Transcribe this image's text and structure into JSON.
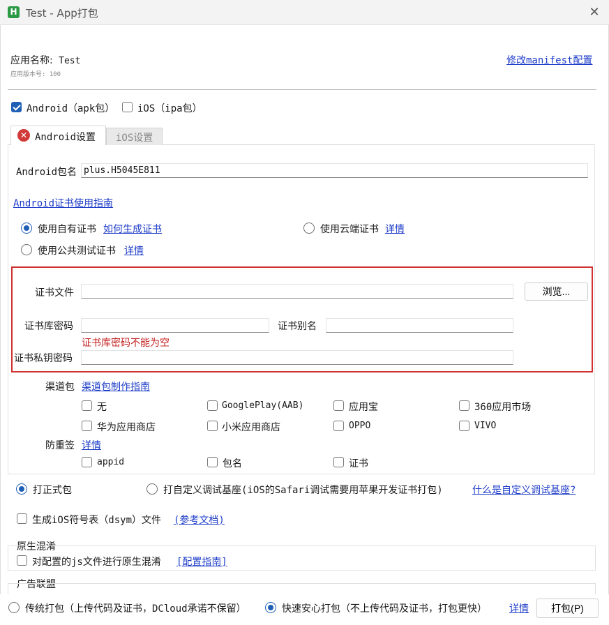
{
  "window": {
    "title": "Test - App打包",
    "app_icon": "H"
  },
  "app_info": {
    "name_label": "应用名称:",
    "name": "Test",
    "version_text": "应用版本号: 100",
    "edit_manifest": "修改manifest配置"
  },
  "platforms": {
    "android": {
      "label": "Android（apk包）",
      "checked": true
    },
    "ios": {
      "label": "iOS（ipa包）",
      "checked": false
    }
  },
  "tabs": {
    "android": "Android设置",
    "ios": "iOS设置"
  },
  "android": {
    "package_label": "Android包名",
    "package_value": "plus.H5045E811",
    "cert_guide": "Android证书使用指南",
    "cert_options": {
      "own": "使用自有证书",
      "own_link": "如何生成证书",
      "cloud": "使用云端证书",
      "cloud_link": "详情",
      "public": "使用公共测试证书",
      "public_link": "详情"
    },
    "cert_file_label": "证书文件",
    "browse_button": "浏览...",
    "keystore_password_label": "证书库密码",
    "alias_label": "证书别名",
    "password_error": "证书库密码不能为空",
    "private_key_label": "证书私钥密码",
    "channel_label": "渠道包",
    "channel_guide": "渠道包制作指南",
    "channels": [
      "无",
      "GooglePlay(AAB)",
      "应用宝",
      "360应用市场",
      "华为应用商店",
      "小米应用商店",
      "OPPO",
      "VIVO"
    ],
    "anti_resign_label": "防重签",
    "anti_resign_link": "详情",
    "anti_resign_options": [
      "appid",
      "包名",
      "证书"
    ]
  },
  "build_type": {
    "release": "打正式包",
    "custom_base": "打自定义调试基座(iOS的Safari调试需要用苹果开发证书打包)",
    "custom_base_link": "什么是自定义调试基座?"
  },
  "dsym": {
    "label": "生成iOS符号表（dsym）文件",
    "link": "(参考文档)"
  },
  "native_obfuscation": {
    "title": "原生混淆",
    "option": "对配置的js文件进行原生混淆",
    "link": "[配置指南]"
  },
  "ad_alliance": {
    "title": "广告联盟"
  },
  "footer": {
    "traditional": "传统打包（上传代码及证书，DCloud承诺不保留）",
    "fast": "快速安心打包（不上传代码及证书，打包更快）",
    "details": "详情",
    "pack_button": "打包(P)"
  },
  "colors": {
    "accent": "#1f5fb6",
    "link": "#1d3cc8",
    "error": "#c42020",
    "error_box": "#d03030"
  }
}
